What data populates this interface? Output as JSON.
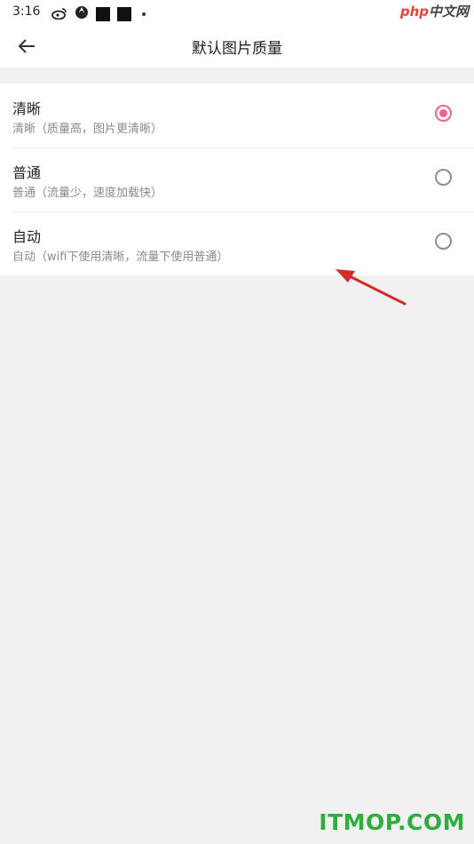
{
  "status_bar": {
    "time": "3:16"
  },
  "header": {
    "title": "默认图片质量"
  },
  "options": [
    {
      "title": "清晰",
      "desc": "清晰（质量高，图片更清晰）",
      "selected": true
    },
    {
      "title": "普通",
      "desc": "普通（流量少，速度加载快）",
      "selected": false
    },
    {
      "title": "自动",
      "desc": "自动（wifi下使用清晰，流量下使用普通）",
      "selected": false
    }
  ],
  "watermarks": {
    "top_php": "php",
    "top_cn": "中文网",
    "bottom": "ITMOP.COM"
  },
  "colors": {
    "accent": "#f0648f",
    "annotation_arrow": "#d42c2c",
    "watermark_green": "#2fae3e"
  }
}
